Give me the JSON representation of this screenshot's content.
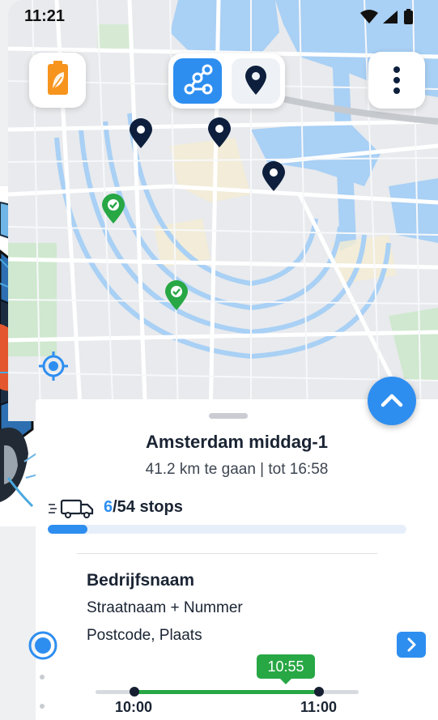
{
  "status_bar": {
    "time": "11:21",
    "icons": [
      "wifi-icon",
      "cell-signal-icon",
      "battery-icon"
    ]
  },
  "top_controls": {
    "battery_icon": "battery-leaf-icon",
    "route_icon": "route-icon",
    "pin_icon": "map-pin-icon",
    "menu_icon": "more-vertical-icon",
    "accent_color": "#2e8ef0"
  },
  "map": {
    "pins_pending": [
      "map-pin-icon",
      "map-pin-icon",
      "map-pin-icon"
    ],
    "pins_done": [
      "check-pin-icon",
      "check-pin-icon"
    ],
    "pending_color": "#0d1f3c",
    "done_color": "#28a745"
  },
  "route": {
    "title": "Amsterdam middag-1",
    "subtitle": "41.2 km te gaan | tot 16:58",
    "stops_done": "6",
    "stops_total": "/54 stops",
    "progress_fraction": 0.111
  },
  "stop": {
    "name": "Bedrijfsnaam",
    "street": "Straatnaam + Nummer",
    "city": "Postcode, Plaats",
    "window_start": "10:00",
    "window_end": "11:00",
    "eta": "10:55",
    "status_color": "#28a745"
  }
}
